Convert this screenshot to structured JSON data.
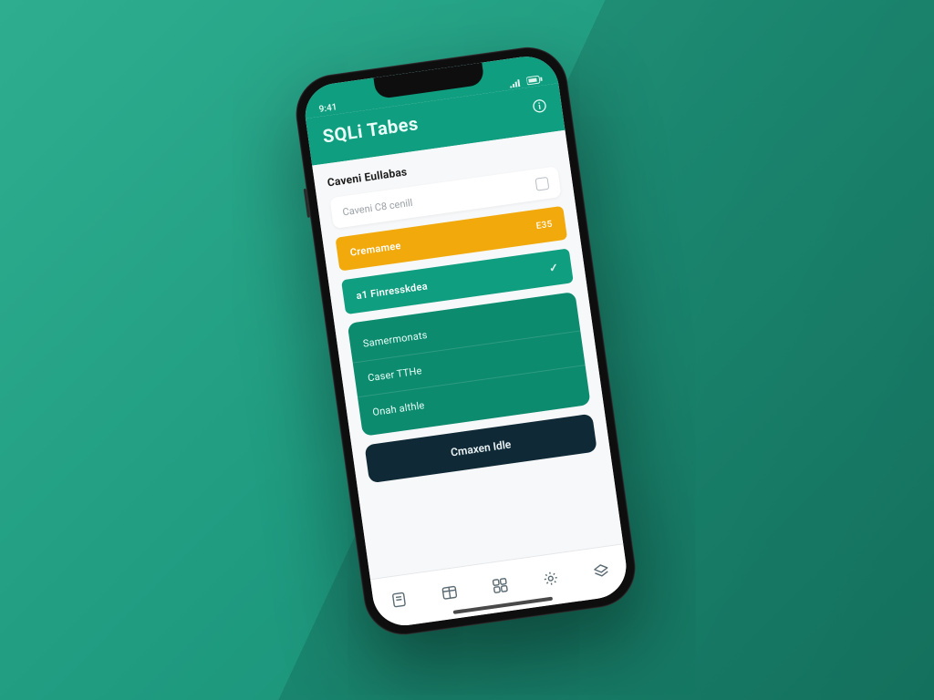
{
  "status": {
    "time": "9:41",
    "signal_label": "signal",
    "battery_label": "battery"
  },
  "header": {
    "title": "SQLi Tabes",
    "info_icon": "info"
  },
  "section": {
    "title": "Caveni Eullabas"
  },
  "cards": {
    "input_placeholder": "Caveni C8 cenill"
  },
  "pills": {
    "amber_label": "Cremamee",
    "amber_suffix": "E35",
    "green_label": "a1 Finresskdea",
    "green_check": "✓"
  },
  "panel": {
    "rows": [
      "Samermonats",
      "Caser TTHe",
      "Onah althle"
    ]
  },
  "cta": {
    "label": "Cmaxen Idle"
  },
  "tabs": {
    "items": [
      "doc",
      "table",
      "grid",
      "settings",
      "layers"
    ]
  }
}
